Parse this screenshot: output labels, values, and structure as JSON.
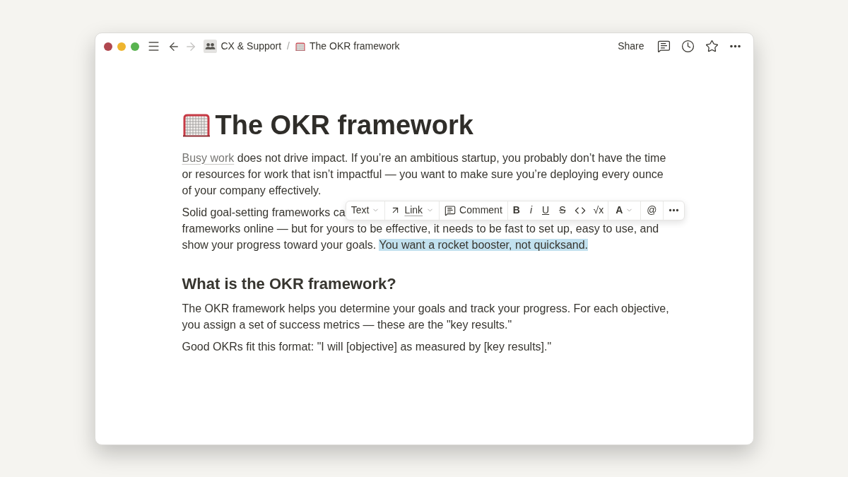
{
  "window": {
    "nav": {
      "back_disabled": false,
      "forward_disabled": true
    },
    "breadcrumb": [
      {
        "kind": "teamspace",
        "label": "CX & Support"
      },
      {
        "kind": "page",
        "label": "The OKR framework"
      }
    ],
    "separator": "/",
    "share": "Share"
  },
  "page": {
    "title": "The OKR framework",
    "blocks": [
      {
        "kind": "paragraph",
        "segments": [
          {
            "kind": "link",
            "text": "Busy work"
          },
          {
            "kind": "text",
            "text": " does not drive impact. If you’re an ambitious startup, you probably don’t have the time or resources for work that isn’t impactful — you want to make sure you’re deploying every ounce of your company effectively."
          }
        ]
      },
      {
        "kind": "covered_paragraph",
        "visible_start": "Solid goal-setting frameworks ca",
        "segments": [
          {
            "kind": "text",
            "text": "frameworks online — but for yours to be effective, it needs to be fast to set up, easy to use, and show your progress toward your goals. "
          },
          {
            "kind": "highlight",
            "text": "You want a rocket booster, not quicksand."
          }
        ]
      },
      {
        "kind": "heading",
        "text": "What is the OKR framework?"
      },
      {
        "kind": "paragraph",
        "segments": [
          {
            "kind": "text",
            "text": "The OKR framework helps you determine your goals and track your progress. For each objective, you assign a set of success metrics — these are the \"key results.\""
          }
        ]
      },
      {
        "kind": "paragraph",
        "segments": [
          {
            "kind": "text",
            "text": "Good OKRs fit this format: \"I will [objective] as measured by [key results].\""
          }
        ]
      }
    ]
  },
  "format_toolbar": {
    "groups": [
      [
        {
          "kind": "turn_into",
          "label": "Text"
        }
      ],
      [
        {
          "kind": "link",
          "label": "Link"
        }
      ],
      [
        {
          "kind": "comment",
          "label": "Comment"
        }
      ],
      [
        {
          "kind": "bold",
          "label": "B"
        },
        {
          "kind": "italic",
          "label": "i"
        },
        {
          "kind": "underline",
          "label": "U"
        },
        {
          "kind": "strike",
          "label": "S"
        },
        {
          "kind": "code"
        },
        {
          "kind": "equation",
          "label": "√x"
        }
      ],
      [
        {
          "kind": "color",
          "label": "A"
        }
      ],
      [
        {
          "kind": "mention",
          "label": "@"
        }
      ],
      [
        {
          "kind": "more"
        }
      ]
    ]
  }
}
